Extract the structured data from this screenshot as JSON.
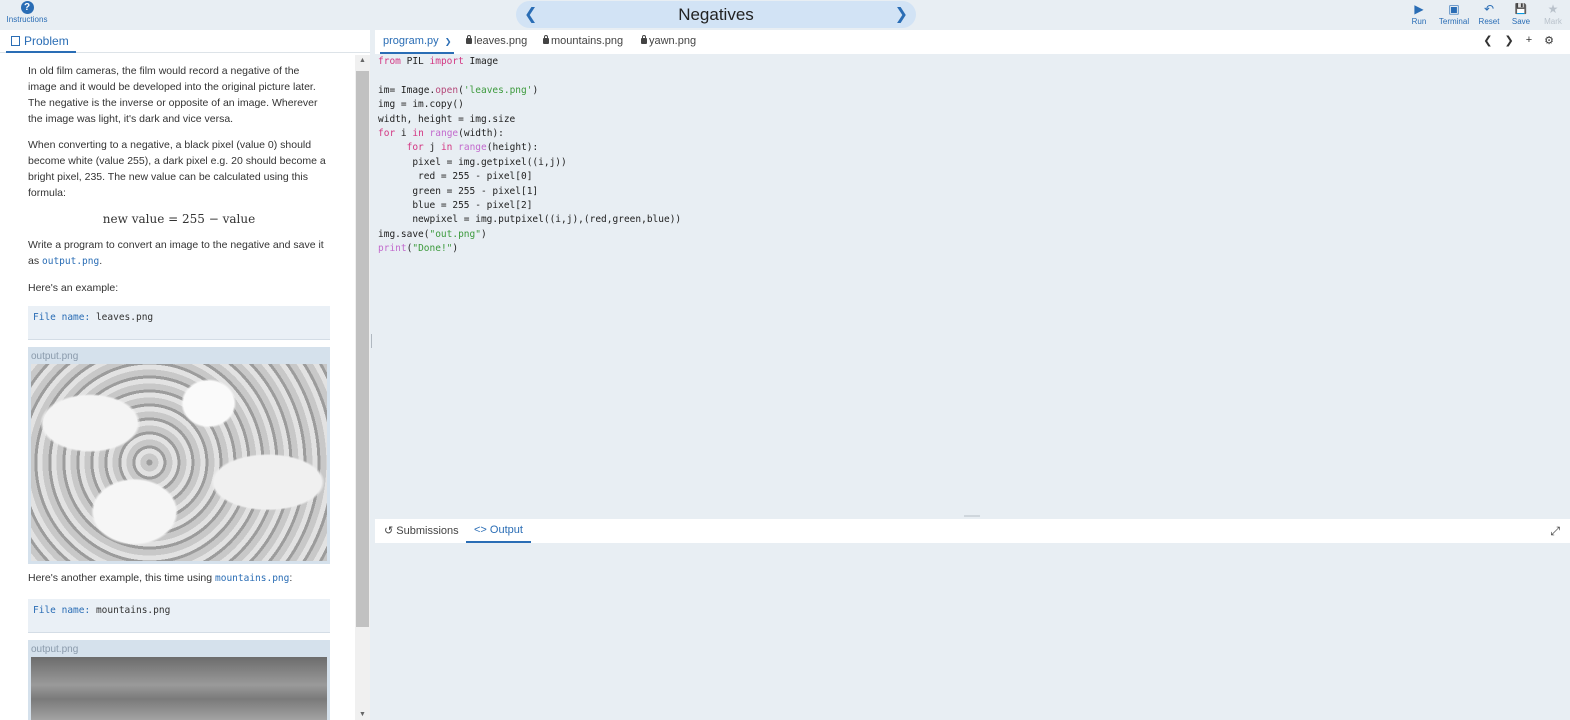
{
  "header": {
    "instructions_label": "Instructions",
    "title": "Negatives",
    "prev_glyph": "❮",
    "next_glyph": "❯",
    "toolbar": [
      {
        "name": "run",
        "label": "Run",
        "icon": "play-icon",
        "glyph": "▶"
      },
      {
        "name": "terminal",
        "label": "Terminal",
        "icon": "terminal-icon",
        "glyph": "▣"
      },
      {
        "name": "reset",
        "label": "Reset",
        "icon": "undo-icon",
        "glyph": "↶"
      },
      {
        "name": "save",
        "label": "Save",
        "icon": "floppy-icon",
        "glyph": "💾"
      },
      {
        "name": "mark",
        "label": "Mark",
        "icon": "star-icon",
        "glyph": "★"
      }
    ]
  },
  "problem": {
    "tab_label": "Problem",
    "p1": "In old film cameras, the film would record a negative of the image and it would be developed into the original picture later. The negative is the inverse or opposite of an image. Wherever the image was light, it's dark and vice versa.",
    "p2": "When converting to a negative, a black pixel (value 0) should become white (value 255), a dark pixel e.g. 20 should become a bright pixel, 235. The new value can be calculated using this formula:",
    "formula": "new value = 255 − value",
    "p3_before": "Write a program to convert an image to the negative and save it as ",
    "p3_code": "output.png",
    "p3_after": ".",
    "p4": "Here's an example:",
    "example1_key": "File name:",
    "example1_val": "leaves.png",
    "output_label_1": "output.png",
    "p5_before": "Here's another example, this time using ",
    "p5_code": "mountains.png",
    "p5_after": ":",
    "example2_key": "File name:",
    "example2_val": "mountains.png",
    "output_label_2": "output.png"
  },
  "editor": {
    "tabs": [
      {
        "label": "program.py",
        "active": true,
        "locked": false
      },
      {
        "label": "leaves.png",
        "active": false,
        "locked": true
      },
      {
        "label": "mountains.png",
        "active": false,
        "locked": true
      },
      {
        "label": "yawn.png",
        "active": false,
        "locked": true
      }
    ],
    "active_tab_chevron": "❯",
    "tools": {
      "prev": "❮",
      "next": "❯",
      "add": "+",
      "settings": "⚙"
    }
  },
  "bottom": {
    "submissions_label": "Submissions",
    "output_label": "Output",
    "submissions_icon": "↺",
    "output_icon": "<>",
    "expand_glyph": "⤢"
  }
}
